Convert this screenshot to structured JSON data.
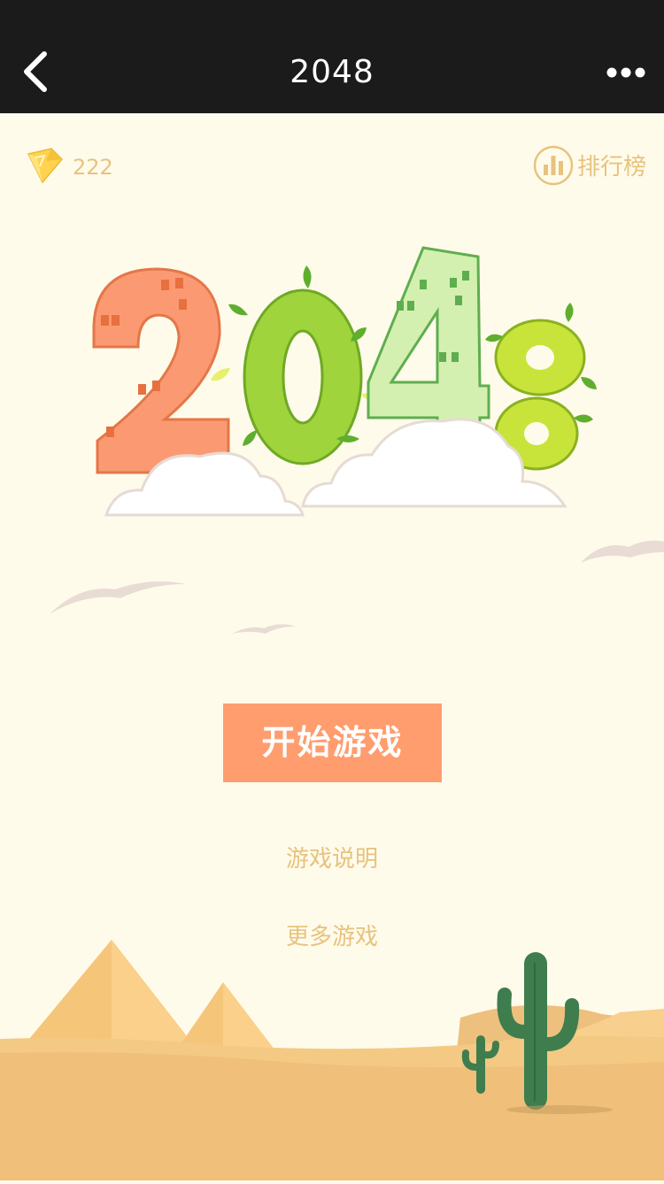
{
  "header": {
    "title": "2048",
    "back_icon": "chevron-left-icon",
    "more_icon": "more-dots-icon"
  },
  "stats": {
    "diamond_icon": "diamond-icon",
    "diamond_count": "222",
    "leaderboard_icon": "bar-chart-icon",
    "leaderboard_label": "排行榜"
  },
  "logo": {
    "text": "2048",
    "colors": {
      "two": "#fb9a72",
      "zero": "#9fd43c",
      "four": "#d3f0b1",
      "eight": "#c8e43a"
    }
  },
  "actions": {
    "start_label": "开始游戏",
    "guide_label": "游戏说明",
    "more_games_label": "更多游戏"
  },
  "colors": {
    "header_bg": "#1b1b1b",
    "page_bg": "#fffbeb",
    "accent": "#ff9d6e",
    "link": "#e7c37e",
    "sand": "#f4c983",
    "cactus": "#3f7d4e"
  }
}
